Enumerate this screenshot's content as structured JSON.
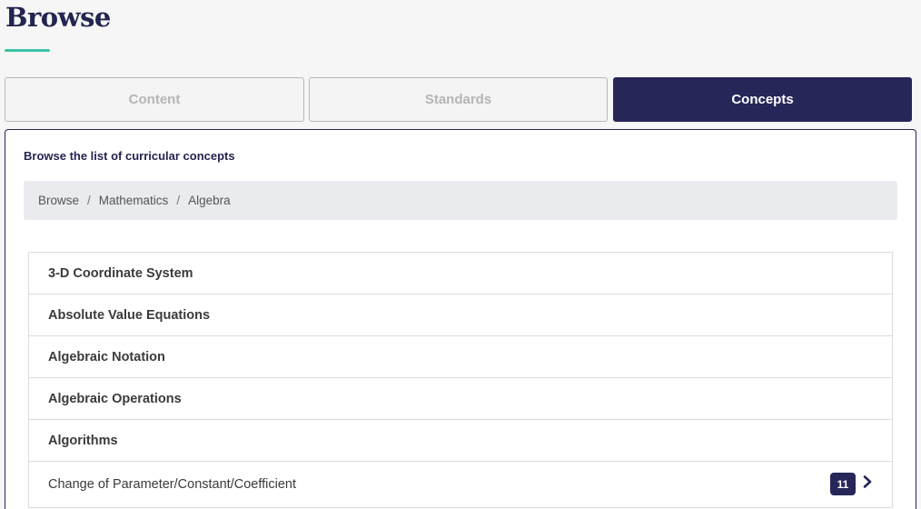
{
  "page": {
    "title": "Browse"
  },
  "tabs": [
    {
      "label": "Content",
      "active": false
    },
    {
      "label": "Standards",
      "active": false
    },
    {
      "label": "Concepts",
      "active": true
    }
  ],
  "panel": {
    "heading": "Browse the list of curricular concepts"
  },
  "breadcrumb": {
    "items": [
      "Browse",
      "Mathematics",
      "Algebra"
    ],
    "separator": "/"
  },
  "concepts": [
    {
      "label": "3-D Coordinate System",
      "bold": true
    },
    {
      "label": "Absolute Value Equations",
      "bold": true
    },
    {
      "label": "Algebraic Notation",
      "bold": true
    },
    {
      "label": "Algebraic Operations",
      "bold": true
    },
    {
      "label": "Algorithms",
      "bold": true
    },
    {
      "label": "Change of Parameter/Constant/Coefficient",
      "bold": false,
      "count": "11",
      "icon": "chevron-right-icon"
    }
  ],
  "colors": {
    "brand": "#262659",
    "accent": "#3cc4a8"
  }
}
